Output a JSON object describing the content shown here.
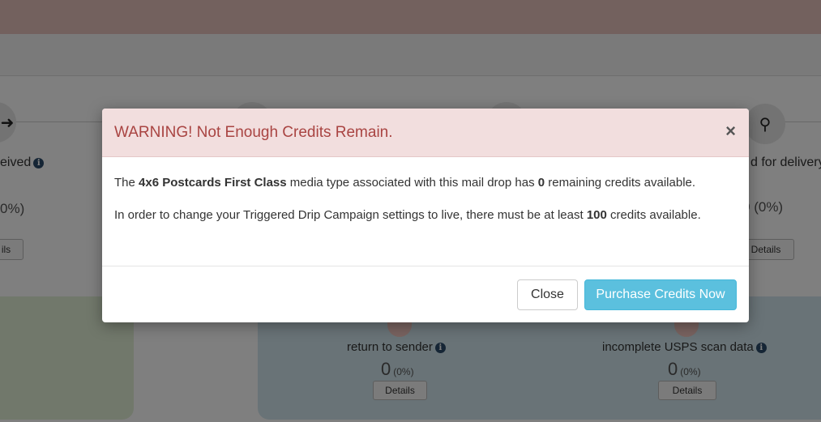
{
  "background": {
    "steps": [
      {
        "label_partial": "eived",
        "count_partial": "0%)",
        "details_partial": "ils",
        "icon": "arrow-icon"
      },
      {
        "label_partial": "d for delivery",
        "count_partial": "0",
        "percent": "(0%)",
        "details": "Details",
        "icon": "person-pin-icon"
      }
    ],
    "cards": [
      {
        "label": "return to sender",
        "count": "0",
        "percent": "(0%)",
        "details": "Details"
      },
      {
        "label": "incomplete USPS scan data",
        "count": "0",
        "percent": "(0%)",
        "details": "Details"
      }
    ],
    "info_glyph": "i"
  },
  "modal": {
    "title": "WARNING! Not Enough Credits Remain.",
    "close_glyph": "×",
    "paragraph1": {
      "prefix": "The ",
      "media_type": "4x6 Postcards First Class",
      "middle": " media type associated with this mail drop has ",
      "remaining": "0",
      "suffix": " remaining credits available."
    },
    "paragraph2": {
      "prefix": "In order to change your Triggered Drip Campaign settings to live, there must be at least ",
      "minimum": "100",
      "suffix": " credits available."
    },
    "buttons": {
      "close": "Close",
      "purchase": "Purchase Credits Now"
    }
  },
  "colors": {
    "warning_text": "#a94442",
    "warning_bg": "#f2dede",
    "info_button": "#5bc0de"
  }
}
